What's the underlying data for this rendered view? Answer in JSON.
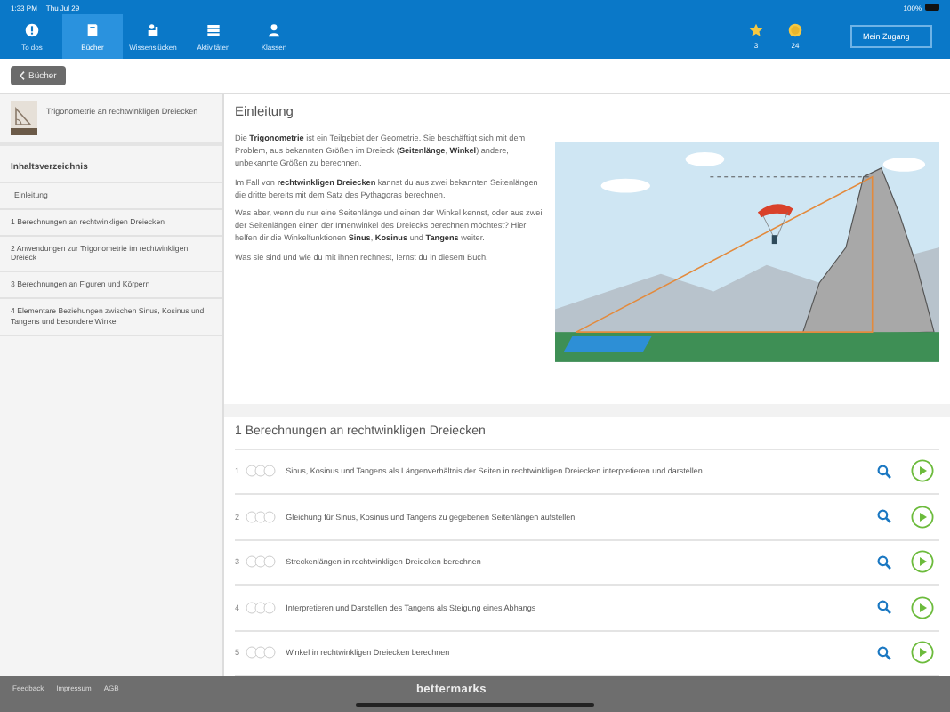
{
  "status_bar": {
    "time": "1:33 PM",
    "date": "Thu Jul 29",
    "battery": "100%"
  },
  "nav": {
    "tabs": [
      {
        "label": "To dos",
        "selected": false
      },
      {
        "label": "Bücher",
        "selected": true
      },
      {
        "label": "Wissenslücken",
        "selected": false
      },
      {
        "label": "Aktivitäten",
        "selected": false
      },
      {
        "label": "Klassen",
        "selected": false
      }
    ],
    "stars": "3",
    "coins": "24",
    "account_button": "Mein Zugang"
  },
  "back_button": "Bücher",
  "sidebar": {
    "book_title": "Trigonometrie an rechtwinkligen Dreiecken",
    "toc_heading": "Inhaltsverzeichnis",
    "items": [
      "Einleitung",
      "1 Berechnungen an rechtwinkligen Dreiecken",
      "2 Anwendungen zur Trigonometrie im rechtwinkligen Dreieck",
      "3 Berechnungen an Figuren und Körpern",
      "4 Elementare Beziehungen zwischen Sinus, Kosinus und Tangens und besondere Winkel"
    ]
  },
  "intro": {
    "title": "Einleitung",
    "paragraphs": [
      "Die **Trigonometrie** ist ein Teilgebiet der Geometrie. Sie beschäftigt sich mit dem Problem, aus bekannten Größen im Dreieck (**Seitenlänge**, **Winkel**) andere, unbekannte Größen zu berechnen.",
      "Im Fall von **rechtwinkligen Dreiecken** kannst du aus zwei bekannten Seitenlängen die dritte bereits mit dem Satz des Pythagoras berechnen.",
      "Was aber, wenn du nur eine Seitenlänge und einen der Winkel kennst, oder aus zwei der Seitenlängen einen der Innenwinkel des Dreiecks berechnen möchtest? Hier helfen dir die Winkelfunktionen **Sinus**, **Kosinus** und **Tangens** weiter.",
      "Was sie sind und wie du mit ihnen rechnest, lernst du in diesem Buch."
    ]
  },
  "chapter": {
    "title": "1  Berechnungen an rechtwinkligen Dreiecken",
    "lessons": [
      {
        "number": "1",
        "title": "Sinus, Kosinus und Tangens als Längenverhältnis der Seiten in rechtwinkligen Dreiecken interpretieren und darstellen"
      },
      {
        "number": "2",
        "title": "Gleichung für Sinus, Kosinus und Tangens zu gegebenen Seitenlängen aufstellen"
      },
      {
        "number": "3",
        "title": "Streckenlängen in rechtwinkligen Dreiecken berechnen"
      },
      {
        "number": "4",
        "title": "Interpretieren und Darstellen des Tangens als Steigung eines Abhangs"
      },
      {
        "number": "5",
        "title": "Winkel in rechtwinkligen Dreiecken berechnen"
      }
    ]
  },
  "footer": {
    "links": [
      "Feedback",
      "Impressum",
      "AGB"
    ],
    "logo": "bettermarks"
  }
}
